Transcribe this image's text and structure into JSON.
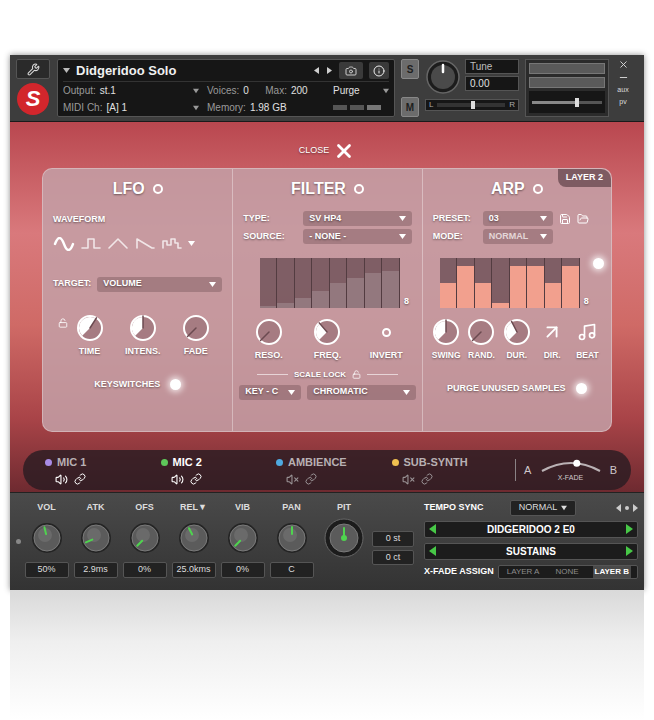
{
  "header": {
    "logo": "S",
    "title": "Didgeridoo Solo",
    "output_label": "Output:",
    "output": "st.1",
    "voices_label": "Voices:",
    "voices": "0",
    "max_label": "Max:",
    "max": "200",
    "purge": "Purge",
    "midi_label": "MIDI Ch:",
    "midi": "[A] 1",
    "memory_label": "Memory:",
    "memory": "1.98 GB",
    "solo": "S",
    "mute": "M",
    "tune_label": "Tune",
    "tune_value": "0.00",
    "tune_level": 0.5,
    "pan_left": "L",
    "pan_right": "R",
    "pan_level": 0.5,
    "volume_level": 0.62,
    "side_labels": [
      "aux",
      "pv"
    ]
  },
  "close_label": "CLOSE",
  "layer_badge": "LAYER 2",
  "lfo": {
    "title": "LFO",
    "on": false,
    "waveform_label": "WAVEFORM",
    "waveforms": [
      {
        "kind": "sine",
        "selected": true
      },
      {
        "kind": "square",
        "selected": false
      },
      {
        "kind": "triangle",
        "selected": false
      },
      {
        "kind": "saw",
        "selected": false
      },
      {
        "kind": "random",
        "selected": false
      }
    ],
    "target_label": "TARGET:",
    "target": "VOLUME",
    "time_locked": false,
    "knobs": [
      {
        "label": "TIME",
        "level": 0.62
      },
      {
        "label": "INTENS.",
        "level": 0.5
      },
      {
        "label": "FADE",
        "level": 0
      }
    ],
    "keyswitches": {
      "label": "KEYSWITCHES",
      "on": true
    }
  },
  "filter": {
    "title": "FILTER",
    "on": false,
    "type_label": "TYPE:",
    "type": "SV HP4",
    "source_label": "SOURCE:",
    "source": "- NONE -",
    "steps": [
      0.05,
      0.1,
      0.2,
      0.35,
      0.5,
      0.6,
      0.7,
      0.75
    ],
    "step_count": "8",
    "knobs": [
      {
        "label": "RESO.",
        "level": 0
      },
      {
        "label": "FREQ.",
        "level": 0.35
      }
    ],
    "invert": {
      "label": "INVERT",
      "on": false
    },
    "scale_lock_label": "SCALE LOCK",
    "scale_locked": false,
    "key": "KEY - C",
    "scale": "CHROMATIC"
  },
  "arp": {
    "title": "ARP",
    "on": false,
    "preset_label": "PRESET:",
    "preset": "03",
    "mode_label": "MODE:",
    "mode": "NORMAL",
    "mode_disabled": true,
    "steps": [
      0.5,
      0.85,
      0.5,
      0.1,
      0.85,
      0.85,
      0.5,
      0.85
    ],
    "step_count": "8",
    "steps_on": true,
    "controls": [
      {
        "label": "SWING",
        "kind": "knob",
        "level": 0.5
      },
      {
        "label": "RAND.",
        "kind": "knob",
        "level": 0
      },
      {
        "label": "DUR.",
        "kind": "knob",
        "level": 0.4
      },
      {
        "label": "DIR.",
        "kind": "direction"
      },
      {
        "label": "BEAT",
        "kind": "beat"
      }
    ],
    "purge": {
      "label": "PURGE UNUSED SAMPLES",
      "on": true
    }
  },
  "mics": {
    "channels": [
      {
        "name": "MIC 1",
        "color": "#a98be6",
        "selected": false,
        "muted": false
      },
      {
        "name": "MIC 2",
        "color": "#5fc85a",
        "selected": true,
        "muted": false
      },
      {
        "name": "AMBIENCE",
        "color": "#4fa9e0",
        "selected": false,
        "muted": true
      },
      {
        "name": "SUB-SYNTH",
        "color": "#f0c050",
        "selected": false,
        "muted": true
      }
    ],
    "xfade": {
      "a": "A",
      "label": "X-FADE",
      "b": "B",
      "level": 0.6
    }
  },
  "controls": {
    "knobs": [
      {
        "label": "VOL",
        "value": "50%",
        "level": 0.45
      },
      {
        "label": "ATK",
        "value": "2.9ms",
        "level": 0.08
      },
      {
        "label": "OFS",
        "value": "0%",
        "level": 0
      },
      {
        "label": "REL▼",
        "value": "25.0kms",
        "level": 0.4
      },
      {
        "label": "VIB",
        "value": "0%",
        "level": 0
      },
      {
        "label": "PAN",
        "value": "C",
        "level": 0.5
      }
    ],
    "pitch": {
      "label": "PIT",
      "level": 0.5,
      "semitones": "0 st",
      "cents": "0 ct"
    },
    "tempo_sync": "TEMPO SYNC",
    "tempo_mode": "NORMAL",
    "articulations": [
      "DIDGERIDOO 2 E0",
      "SUSTAINS"
    ],
    "xfade_assign": {
      "label": "X-FADE ASSIGN",
      "options": [
        {
          "label": "LAYER A",
          "selected": false
        },
        {
          "label": "NONE",
          "selected": false
        },
        {
          "label": "LAYER B",
          "selected": true
        }
      ]
    }
  }
}
